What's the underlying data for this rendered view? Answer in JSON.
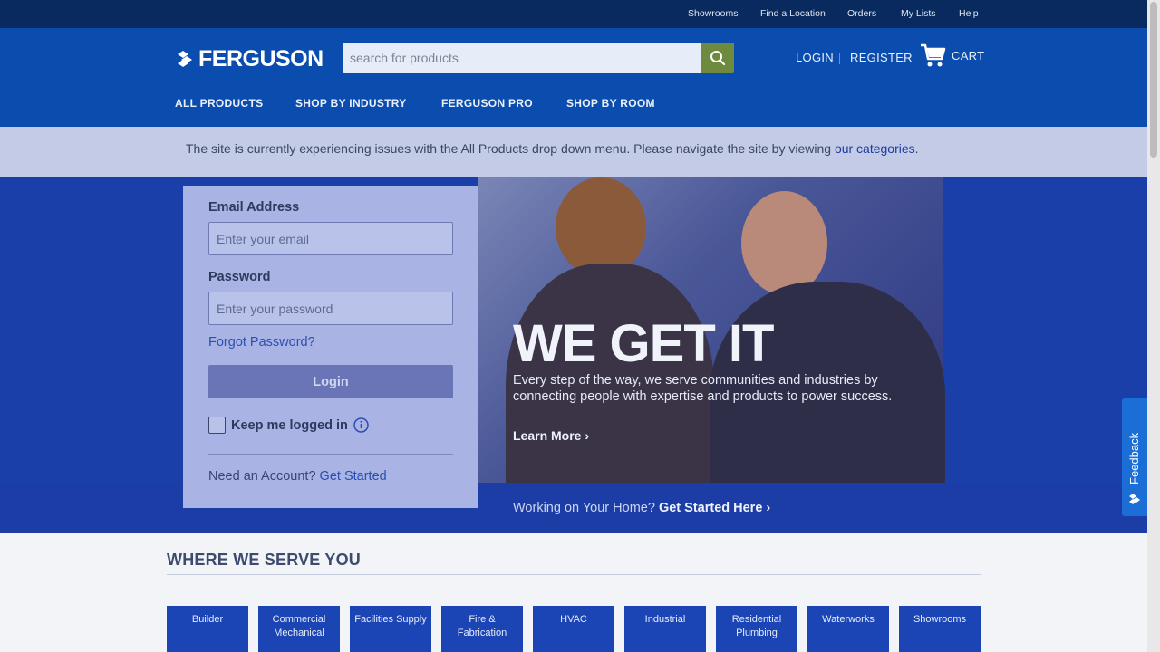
{
  "util_nav": [
    "Showrooms",
    "Find a Location",
    "Orders",
    "My Lists",
    "Help"
  ],
  "header": {
    "logo_text": "FERGUSON",
    "search_placeholder": "search for products",
    "login": "LOGIN",
    "register": "REGISTER",
    "cart": "CART"
  },
  "main_nav": [
    "ALL PRODUCTS",
    "SHOP BY INDUSTRY",
    "FERGUSON PRO",
    "SHOP BY ROOM"
  ],
  "alert": {
    "text": "The site is currently experiencing issues with the All Products drop down menu. Please navigate the site by viewing ",
    "link": "our categories",
    "end": "."
  },
  "login_form": {
    "email_label": "Email Address",
    "email_placeholder": "Enter your email",
    "password_label": "Password",
    "password_placeholder": "Enter your password",
    "forgot": "Forgot Password?",
    "login_button": "Login",
    "keep_logged_in": "Keep me logged in",
    "need_account": "Need an Account?",
    "get_started": "Get Started"
  },
  "hero": {
    "title": "WE GET IT",
    "description": "Every step of the way, we serve communities and industries by connecting people with expertise and products to power success.",
    "learn_more": "Learn More ›",
    "working_prefix": "Working on Your Home?",
    "working_link": "Get Started Here ›"
  },
  "serve": {
    "title": "WHERE WE SERVE YOU",
    "tiles": [
      "Builder",
      "Commercial Mechanical",
      "Facilities Supply",
      "Fire & Fabrication",
      "HVAC",
      "Industrial",
      "Residential Plumbing",
      "Waterworks",
      "Showrooms"
    ]
  },
  "feedback": "Feedback",
  "colors": {
    "util_bar": "#092a5e",
    "header": "#0b4dae",
    "search_button": "#6e8a3e",
    "hero": "#1a3fa8",
    "feedback_tab": "#1b6ed6"
  },
  "icons": [
    "ferguson-logo-icon",
    "search-icon",
    "cart-icon",
    "info-icon",
    "feedback-logo-icon"
  ]
}
